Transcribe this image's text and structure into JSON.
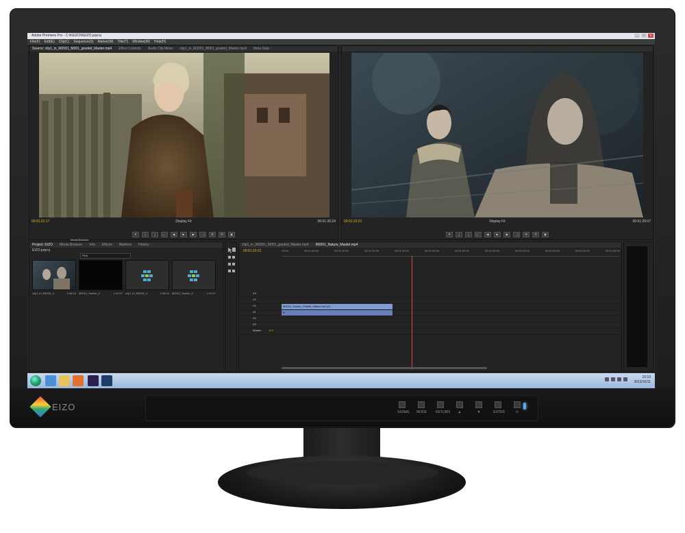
{
  "app": {
    "title": "Adobe Premiere Pro - C:\\KEIZO\\KEIZO.prproj",
    "menus": [
      "File(F)",
      "Edit(E)",
      "Clip(C)",
      "Sequence(S)",
      "Marker(M)",
      "Title(T)",
      "Window(W)",
      "Help(H)"
    ],
    "window_buttons": [
      "_",
      "□",
      "x"
    ]
  },
  "source_monitor": {
    "tabs": [
      "Source: clip1_in_M2001_M001_graded_Master.mp4",
      "Effect Controls",
      "Audio Clip Mixer",
      "clip1_in_M2001_M001_graded_Master.mp4",
      "Meta Data"
    ],
    "timecode_in": "00:01:21:17",
    "fit": "Display Fit",
    "timecode_out": "00:01:36:24",
    "controls": [
      "▼",
      "{",
      "}",
      "|←",
      "◀|",
      "▶",
      "|▶",
      "→|",
      "⊞",
      "⊟",
      "▣"
    ]
  },
  "program_monitor": {
    "timecode_in": "00:01:23:21",
    "fit": "Display Fit",
    "timecode_out": "00:01:29:07",
    "controls": [
      "▼",
      "{",
      "}",
      "|←",
      "◀|",
      "▶",
      "|▶",
      "→|",
      "⊞",
      "⊟",
      "▣"
    ]
  },
  "media_browser_label": "Media Browser",
  "project_panel": {
    "tabs": [
      "Project: EIZO",
      "Media Browser",
      "Info",
      "Effects",
      "Markers",
      "History"
    ],
    "path": "EIZO.prproj",
    "search_placeholder": "Find",
    "items": [
      {
        "name": "clip1_in_M2001_0",
        "duration": "1:36:24"
      },
      {
        "name": "M2001_Nature_0",
        "duration": "1:31:07"
      },
      {
        "name": "clip1_in_M2001_0",
        "duration": "1:36:24"
      },
      {
        "name": "M2001_Nature_0",
        "duration": "1:31:07"
      }
    ]
  },
  "timeline": {
    "tabs": [
      "clip1_in_M2001_M001_graded_Master.mp4",
      "M2001_Nature_Master.mp4"
    ],
    "timecode": "00:01:23:21",
    "ruler": [
      "00:00",
      "00:01:00:00",
      "00:01:10:00",
      "00:01:20:00",
      "00:01:30:00",
      "00:01:40:00",
      "00:01:50:00",
      "00:02:00:00",
      "00:02:10:00",
      "00:02:20:00",
      "00:02:30:00",
      "00:02:40:00"
    ],
    "tracks": [
      "V3",
      "V2",
      "V1",
      "A1",
      "A2",
      "A3",
      "Master"
    ],
    "clips": {
      "video": "M2001_Nature_Ghidali_Maker.mp4 [V]",
      "audio": "fx"
    },
    "master_value": "0.0"
  },
  "taskbar": {
    "time": "10:10",
    "date": "2013/10/11"
  },
  "monitor": {
    "brand": "EIZO",
    "buttons": [
      "SIGNAL",
      "MODE",
      "RETURN",
      "▲",
      "▼",
      "ENTER",
      "⏻"
    ]
  },
  "colors": {
    "timecode": "#e6b822",
    "clip_video": "#7e9bd4",
    "clip_audio": "#6a7fb8",
    "playhead": "#d44"
  }
}
